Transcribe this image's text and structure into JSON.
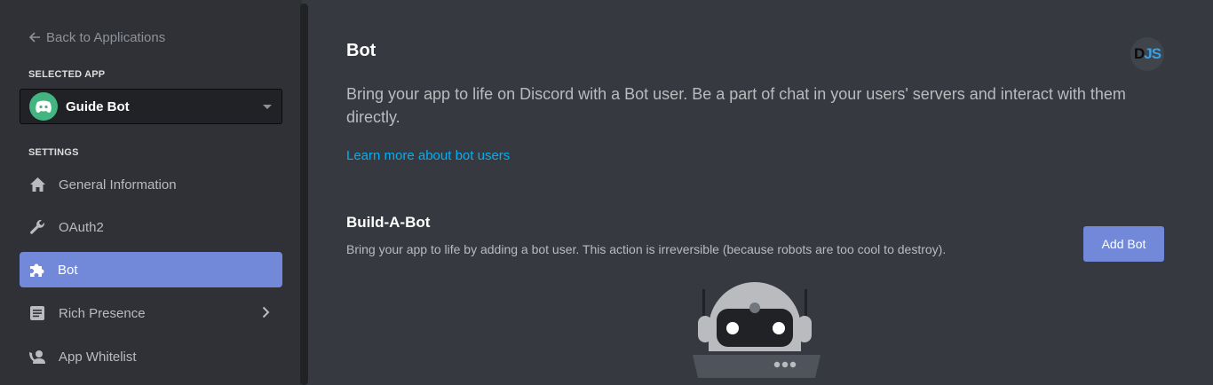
{
  "sidebar": {
    "back_label": "Back to Applications",
    "selected_app_label": "SELECTED APP",
    "selected_app": {
      "name": "Guide Bot",
      "icon": "discord-logo-icon"
    },
    "settings_label": "SETTINGS",
    "items": [
      {
        "label": "General Information",
        "icon": "home-icon",
        "active": false
      },
      {
        "label": "OAuth2",
        "icon": "wrench-icon",
        "active": false
      },
      {
        "label": "Bot",
        "icon": "puzzle-icon",
        "active": true
      },
      {
        "label": "Rich Presence",
        "icon": "document-icon",
        "active": false,
        "expandable": true
      },
      {
        "label": "App Whitelist",
        "icon": "user-phone-icon",
        "active": false
      }
    ]
  },
  "main": {
    "title": "Bot",
    "avatar_text_d": "D",
    "avatar_text_js": "JS",
    "description": "Bring your app to life on Discord with a Bot user. Be a part of chat in your users' servers and interact with them directly.",
    "learn_more": "Learn more about bot users",
    "section": {
      "title": "Build-A-Bot",
      "description": "Bring your app to life by adding a bot user. This action is irreversible (because robots are too cool to destroy).",
      "button_label": "Add Bot"
    }
  },
  "colors": {
    "accent": "#7289da",
    "link": "#00b0f4",
    "app_icon_bg": "#43b581",
    "background": "#36393f",
    "sidebar": "#2f3136"
  }
}
